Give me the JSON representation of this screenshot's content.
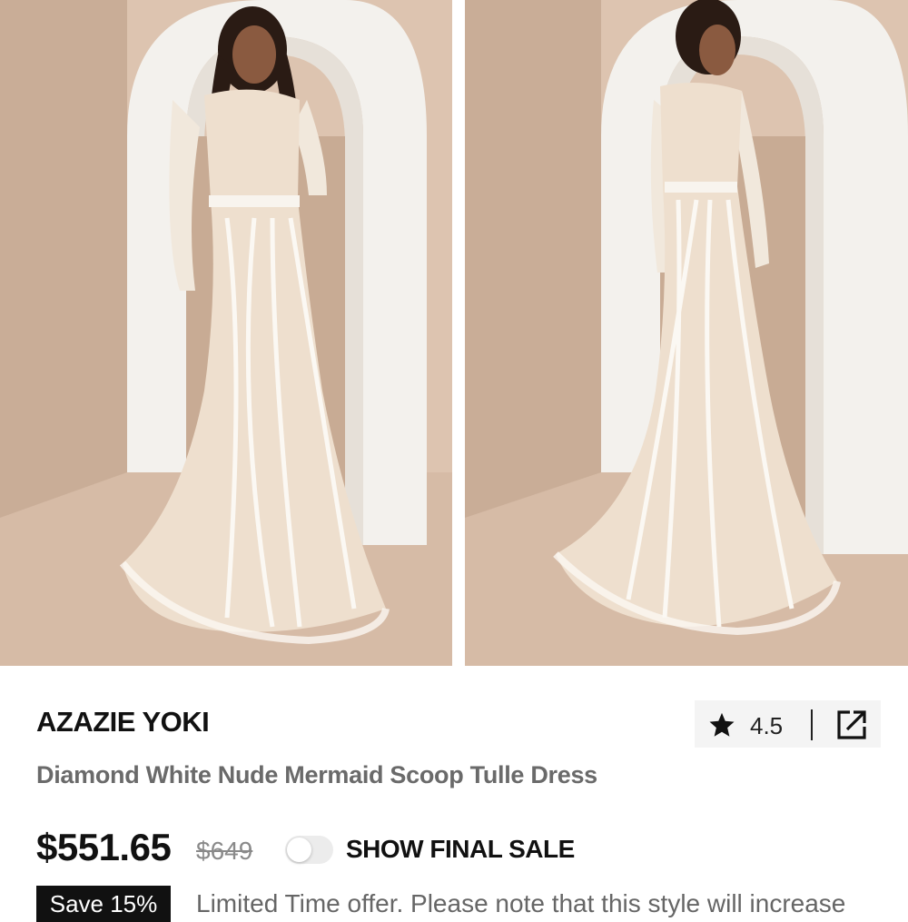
{
  "product": {
    "brand": "AZAZIE YOKI",
    "name": "Diamond White Nude Mermaid Scoop Tulle Dress",
    "price": "$551.65",
    "original_price": "$649",
    "rating": "4.5"
  },
  "final_sale_toggle": {
    "label": "SHOW FINAL SALE",
    "on": false
  },
  "promo": {
    "badge": "Save 15%",
    "text": "Limited Time offer. Please note that this style will increase"
  },
  "icons": {
    "rating": "star-icon",
    "share": "share-external-icon"
  },
  "colors": {
    "wall": "#c9ac95",
    "arch": "#f2f0ec",
    "floor": "#d8bda7",
    "dress": "#efe3d6",
    "text": "#111111",
    "subtext": "#6a6a6a",
    "badge_bg": "#111111"
  }
}
